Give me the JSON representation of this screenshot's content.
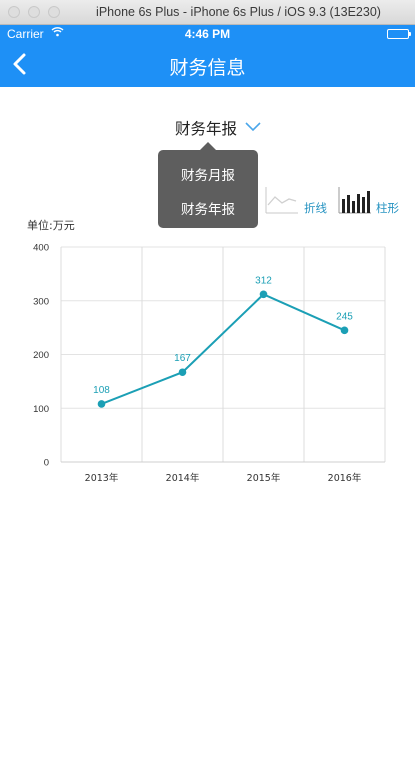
{
  "window": {
    "title": "iPhone 6s Plus - iPhone 6s Plus / iOS 9.3 (13E230)"
  },
  "status_bar": {
    "carrier": "Carrier",
    "wifi_icon": "wifi-icon",
    "time": "4:46 PM",
    "battery_icon": "battery-icon"
  },
  "nav": {
    "back_icon": "chevron-left-icon",
    "title": "财务信息"
  },
  "selector": {
    "label": "财务年报",
    "icon": "chevron-down-icon"
  },
  "dropdown": {
    "options": [
      "财务月报",
      "财务年报"
    ]
  },
  "chart_toggles": {
    "line_label": "折线",
    "bar_label": "柱形"
  },
  "unit_label": "单位:万元",
  "colors": {
    "navbar": "#1e90f6",
    "series": "#1b9fb5",
    "dropdown_bg": "#5e5e5e"
  },
  "chart_data": {
    "type": "line",
    "categories": [
      "2013年",
      "2014年",
      "2015年",
      "2016年"
    ],
    "series": [
      {
        "values": [
          108,
          167,
          312,
          245
        ]
      }
    ],
    "ylim": [
      0,
      400
    ],
    "yticks": [
      0,
      100,
      200,
      300,
      400
    ],
    "grid": true
  }
}
